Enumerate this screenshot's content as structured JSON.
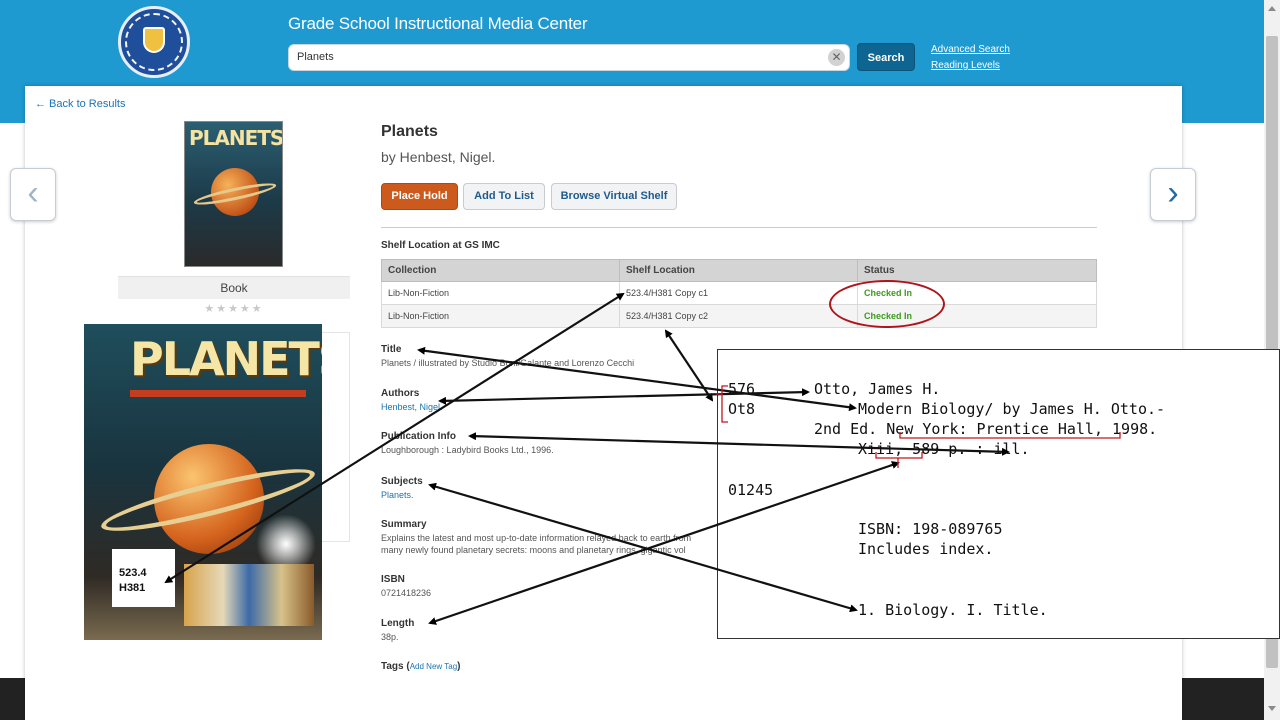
{
  "header": {
    "site_title": "Grade School Instructional Media Center",
    "search_value": "Planets",
    "search_button": "Search",
    "advanced_search": "Advanced Search",
    "reading_levels": "Reading Levels"
  },
  "colors": {
    "header_blue": "#1e9ad0",
    "place_hold_orange": "#cc5a1c",
    "link_blue": "#1a73b4",
    "status_green": "#3d9a1f",
    "annotation_red": "#b0141a"
  },
  "nav": {
    "back_to_results": "← Back to Results",
    "prev_icon": "‹",
    "next_icon": "›"
  },
  "cover": {
    "title_text": "PLANETS",
    "format": "Book",
    "rating_stars": "★★★★★",
    "call_number_line1": "523.4",
    "call_number_line2": "H381"
  },
  "book": {
    "title": "Planets",
    "author": "by Henbest, Nigel."
  },
  "actions": {
    "place_hold": "Place Hold",
    "add_to_list": "Add To List",
    "browse_shelf": "Browse Virtual Shelf"
  },
  "shelf": {
    "heading": "Shelf Location at GS IMC",
    "columns": [
      "Collection",
      "Shelf Location",
      "Status"
    ],
    "rows": [
      {
        "collection": "Lib-Non-Fiction",
        "location": "523.4/H381 Copy c1",
        "status": "Checked In"
      },
      {
        "collection": "Lib-Non-Fiction",
        "location": "523.4/H381 Copy c2",
        "status": "Checked In"
      }
    ]
  },
  "details": {
    "title_label": "Title",
    "title_value": "Planets / illustrated by Studio Boni/Galante and Lorenzo Cecchi",
    "authors_label": "Authors",
    "authors_value": "Henbest, Nigel.",
    "pub_label": "Publication Info",
    "pub_value": "Loughborough : Ladybird Books Ltd., 1996.",
    "subjects_label": "Subjects",
    "subjects_value": "Planets.",
    "summary_label": "Summary",
    "summary_line1": "Explains the latest and most up-to-date information relayed back to earth from",
    "summary_line2": "many newly found planetary secrets: moons and planetary rings, gigantic vol",
    "isbn_label": "ISBN",
    "isbn_value": "0721418236",
    "length_label": "Length",
    "length_value": "38p.",
    "tags_label": "Tags",
    "tags_link": "Add New Tag"
  },
  "catalog_card": {
    "class_number": "576",
    "cutter": "Ot8",
    "author": "Otto, James H.",
    "title_line": "Modern Biology/ by James H. Otto.-",
    "edition_line": "2nd Ed. New York: Prentice Hall, 1998.",
    "collation": "Xiii, 589 p. : ill.",
    "accession": "01245",
    "isbn": "ISBN: 198-089765",
    "note": "Includes index.",
    "tracing": "1. Biology. I. Title."
  }
}
